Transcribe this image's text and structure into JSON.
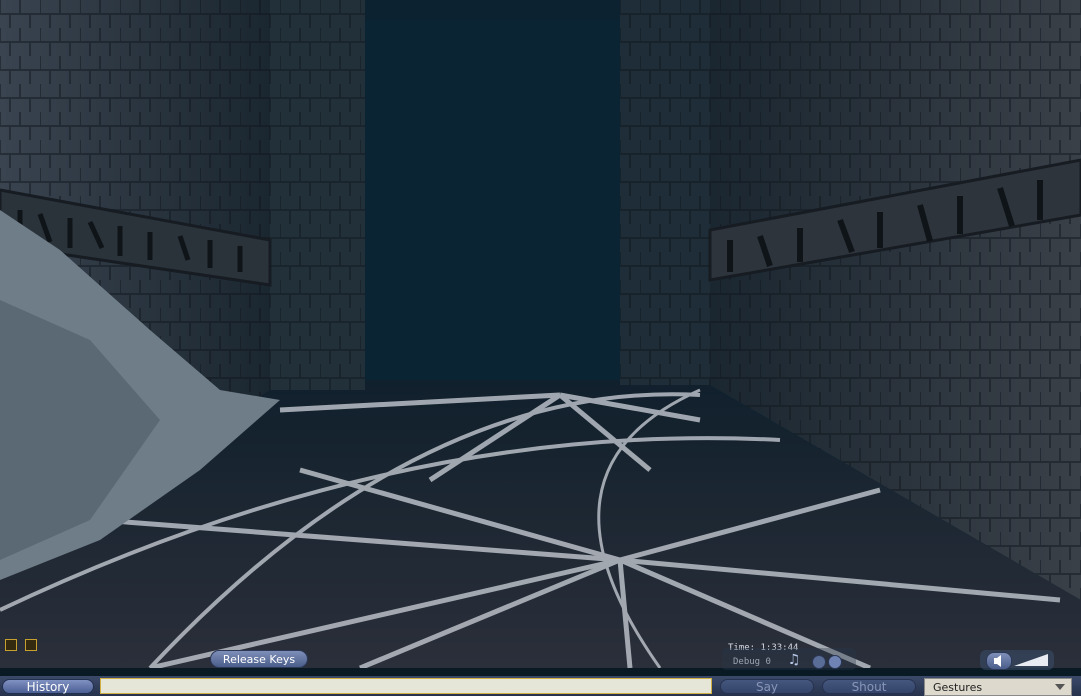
{
  "hud": {
    "time_label": "Time: 1:33:44",
    "debug_label": "Debug 0"
  },
  "buttons": {
    "release_keys": "Release Keys",
    "history": "History",
    "say": "Say",
    "shout": "Shout"
  },
  "chat": {
    "value": "",
    "placeholder": ""
  },
  "gestures": {
    "selected": "Gestures"
  },
  "icons": {
    "music": "music-note-icon",
    "stop": "media-stop-icon",
    "play": "media-play-icon",
    "volume": "volume-icon"
  }
}
